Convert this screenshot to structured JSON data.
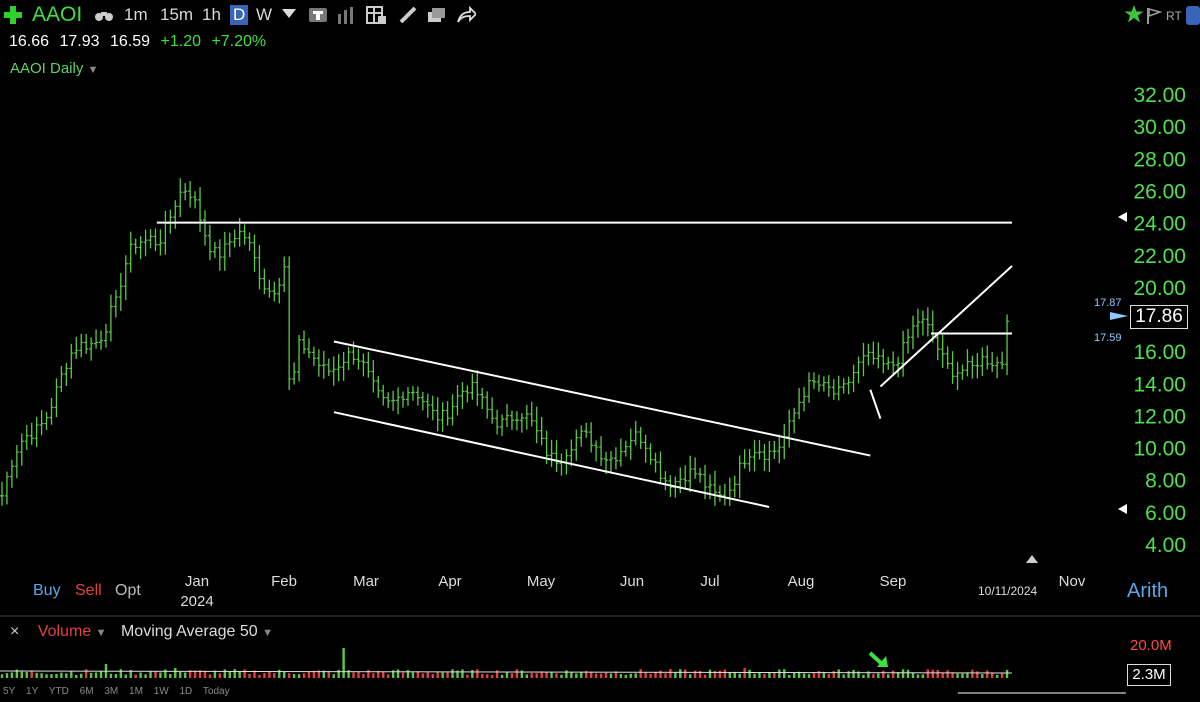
{
  "toolbar": {
    "symbol": "AAOI",
    "intervals": [
      "1m",
      "15m",
      "1h",
      "D",
      "W"
    ],
    "selected_interval": "D",
    "rt_label": "RT"
  },
  "quote": {
    "open": "16.66",
    "high": "17.93",
    "low": "16.59",
    "change": "+1.20",
    "change_pct": "+7.20%"
  },
  "series_title": "AAOI Daily",
  "price_box": "17.86",
  "small_labels": {
    "upper": "17.87",
    "lower": "17.59"
  },
  "bottom_bar": {
    "buy": "Buy",
    "sell": "Sell",
    "opt": "Opt",
    "date": "10/11/2024",
    "scale": "Arith"
  },
  "volume": {
    "label": "Volume",
    "ma_label": "Moving Average 50",
    "max": "20.0M",
    "current": "2.3M"
  },
  "ranges": [
    "5Y",
    "1Y",
    "YTD",
    "6M",
    "3M",
    "1M",
    "1W",
    "1D",
    "Today"
  ],
  "colors": {
    "up": "#5cc84a",
    "down": "#e34040",
    "axis": "#4ee04e",
    "line": "#ffffff"
  },
  "chart_data": {
    "type": "ohlc",
    "y_ticks": [
      4,
      6,
      8,
      10,
      12,
      14,
      16,
      18,
      20,
      22,
      24,
      26,
      28,
      30,
      32
    ],
    "y_tick_labels": [
      "4.00",
      "6.00",
      "8.00",
      "10.00",
      "12.00",
      "14.00",
      "16.00",
      "18.00",
      "20.00",
      "22.00",
      "24.00",
      "26.00",
      "28.00",
      "30.00",
      "32.00"
    ],
    "ylim": [
      3,
      33.5
    ],
    "x_labels": [
      "Jan",
      "Feb",
      "Mar",
      "Apr",
      "May",
      "Jun",
      "Jul",
      "Aug",
      "Sep",
      "Nov"
    ],
    "x_year_label": "2024",
    "segments": [
      {
        "start": 0,
        "end": 30,
        "from": 7.0,
        "to": 24.0
      },
      {
        "start": 30,
        "end": 58,
        "from": 24.0,
        "to": 22.0
      },
      {
        "start": 58,
        "end": 60,
        "from": 14.0,
        "to": 14.0
      },
      {
        "start": 60,
        "end": 142,
        "from": 15.5,
        "to": 8.0
      },
      {
        "start": 142,
        "end": 154,
        "from": 8.0,
        "to": 9.0
      },
      {
        "start": 154,
        "end": 167,
        "from": 9.0,
        "to": 14.5
      },
      {
        "start": 167,
        "end": 185,
        "from": 14.5,
        "to": 16.5
      },
      {
        "start": 185,
        "end": 196,
        "from": 16.5,
        "to": 14.5
      },
      {
        "start": 196,
        "end": 204,
        "from": 14.5,
        "to": 17.5
      }
    ],
    "bars": 204,
    "lines": [
      {
        "name": "resistance",
        "x0": 0.155,
        "y0": 24.0,
        "x1": 1.0,
        "y1": 24.0
      },
      {
        "name": "channel-top",
        "x0": 0.33,
        "y0": 16.6,
        "x1": 0.86,
        "y1": 9.5
      },
      {
        "name": "channel-bottom",
        "x0": 0.33,
        "y0": 12.2,
        "x1": 0.76,
        "y1": 6.3
      },
      {
        "name": "rising-upper",
        "x0": 0.87,
        "y0": 13.8,
        "x1": 1.0,
        "y1": 21.3
      },
      {
        "name": "short-lower",
        "x0": 0.86,
        "y0": 13.6,
        "x1": 0.87,
        "y1": 11.8
      },
      {
        "name": "flag-top",
        "x0": 0.92,
        "y0": 17.1,
        "x1": 1.0,
        "y1": 17.1
      }
    ],
    "last_close": 17.86
  }
}
